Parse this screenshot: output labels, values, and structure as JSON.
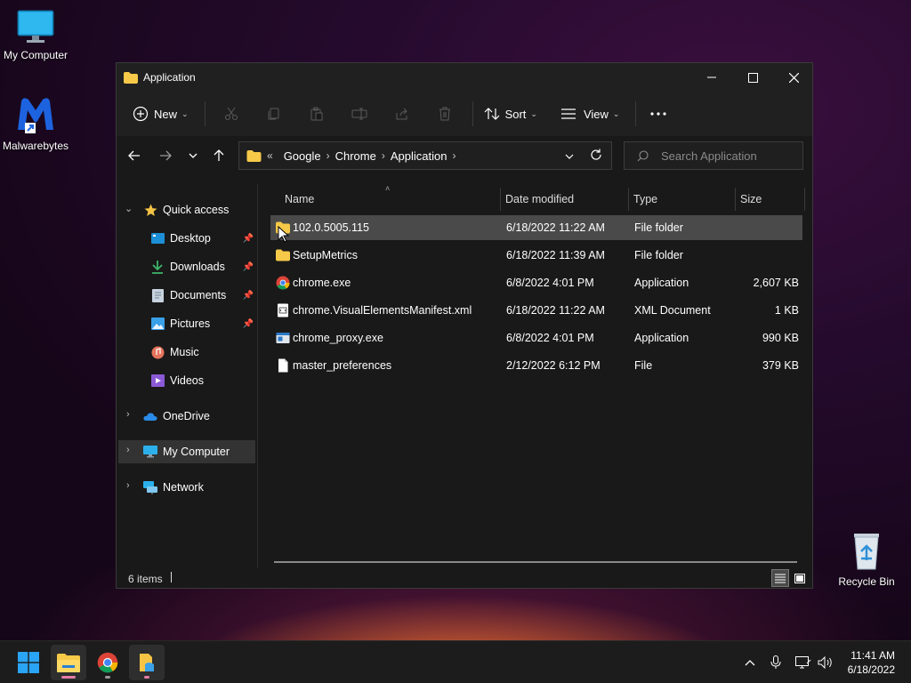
{
  "desktop": {
    "icons": [
      {
        "label": "My Computer",
        "icon": "monitor-icon"
      },
      {
        "label": "Malwarebytes",
        "icon": "malwarebytes-icon"
      },
      {
        "label": "Recycle Bin",
        "icon": "recycle-bin-icon"
      }
    ]
  },
  "window": {
    "title": "Application",
    "controls": {
      "minimize": "minimize-icon",
      "maximize": "maximize-icon",
      "close": "close-icon"
    }
  },
  "commandbar": {
    "new_label": "New",
    "sort_label": "Sort",
    "view_label": "View",
    "icons": [
      "cut-icon",
      "copy-icon",
      "paste-icon",
      "rename-icon",
      "share-icon",
      "delete-icon"
    ]
  },
  "address": {
    "overflow": "«",
    "crumbs": [
      "Google",
      "Chrome",
      "Application"
    ],
    "search_placeholder": "Search Application"
  },
  "sidebar": {
    "quick_access": "Quick access",
    "items": [
      {
        "label": "Desktop",
        "pinned": true
      },
      {
        "label": "Downloads",
        "pinned": true
      },
      {
        "label": "Documents",
        "pinned": true
      },
      {
        "label": "Pictures",
        "pinned": true
      },
      {
        "label": "Music",
        "pinned": false
      },
      {
        "label": "Videos",
        "pinned": false
      }
    ],
    "onedrive": "OneDrive",
    "my_computer": "My Computer",
    "network": "Network"
  },
  "files": {
    "columns": {
      "name": "Name",
      "date": "Date modified",
      "type": "Type",
      "size": "Size"
    },
    "rows": [
      {
        "name": "102.0.5005.115",
        "date": "6/18/2022 11:22 AM",
        "type": "File folder",
        "size": "",
        "icon": "folder-icon",
        "selected": true
      },
      {
        "name": "SetupMetrics",
        "date": "6/18/2022 11:39 AM",
        "type": "File folder",
        "size": "",
        "icon": "folder-icon",
        "selected": false
      },
      {
        "name": "chrome.exe",
        "date": "6/8/2022 4:01 PM",
        "type": "Application",
        "size": "2,607 KB",
        "icon": "chrome-icon",
        "selected": false
      },
      {
        "name": "chrome.VisualElementsManifest.xml",
        "date": "6/18/2022 11:22 AM",
        "type": "XML Document",
        "size": "1 KB",
        "icon": "xml-file-icon",
        "selected": false
      },
      {
        "name": "chrome_proxy.exe",
        "date": "6/8/2022 4:01 PM",
        "type": "Application",
        "size": "990 KB",
        "icon": "exe-icon",
        "selected": false
      },
      {
        "name": "master_preferences",
        "date": "2/12/2022 6:12 PM",
        "type": "File",
        "size": "379 KB",
        "icon": "file-icon",
        "selected": false
      }
    ]
  },
  "status": {
    "count": "6 items"
  },
  "taskbar": {
    "time": "11:41 AM",
    "date": "6/18/2022"
  },
  "colors": {
    "accent": "#0078d4",
    "folder": "#f7c948",
    "selection": "#4a4a4a"
  }
}
